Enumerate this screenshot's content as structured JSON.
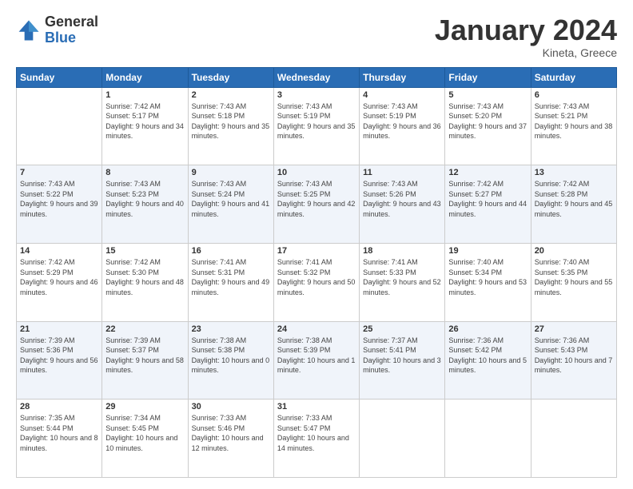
{
  "logo": {
    "general": "General",
    "blue": "Blue"
  },
  "header": {
    "month": "January 2024",
    "location": "Kineta, Greece"
  },
  "weekdays": [
    "Sunday",
    "Monday",
    "Tuesday",
    "Wednesday",
    "Thursday",
    "Friday",
    "Saturday"
  ],
  "weeks": [
    [
      {
        "day": "",
        "sunrise": "",
        "sunset": "",
        "daylight": ""
      },
      {
        "day": "1",
        "sunrise": "Sunrise: 7:42 AM",
        "sunset": "Sunset: 5:17 PM",
        "daylight": "Daylight: 9 hours and 34 minutes."
      },
      {
        "day": "2",
        "sunrise": "Sunrise: 7:43 AM",
        "sunset": "Sunset: 5:18 PM",
        "daylight": "Daylight: 9 hours and 35 minutes."
      },
      {
        "day": "3",
        "sunrise": "Sunrise: 7:43 AM",
        "sunset": "Sunset: 5:19 PM",
        "daylight": "Daylight: 9 hours and 35 minutes."
      },
      {
        "day": "4",
        "sunrise": "Sunrise: 7:43 AM",
        "sunset": "Sunset: 5:19 PM",
        "daylight": "Daylight: 9 hours and 36 minutes."
      },
      {
        "day": "5",
        "sunrise": "Sunrise: 7:43 AM",
        "sunset": "Sunset: 5:20 PM",
        "daylight": "Daylight: 9 hours and 37 minutes."
      },
      {
        "day": "6",
        "sunrise": "Sunrise: 7:43 AM",
        "sunset": "Sunset: 5:21 PM",
        "daylight": "Daylight: 9 hours and 38 minutes."
      }
    ],
    [
      {
        "day": "7",
        "sunrise": "Sunrise: 7:43 AM",
        "sunset": "Sunset: 5:22 PM",
        "daylight": "Daylight: 9 hours and 39 minutes."
      },
      {
        "day": "8",
        "sunrise": "Sunrise: 7:43 AM",
        "sunset": "Sunset: 5:23 PM",
        "daylight": "Daylight: 9 hours and 40 minutes."
      },
      {
        "day": "9",
        "sunrise": "Sunrise: 7:43 AM",
        "sunset": "Sunset: 5:24 PM",
        "daylight": "Daylight: 9 hours and 41 minutes."
      },
      {
        "day": "10",
        "sunrise": "Sunrise: 7:43 AM",
        "sunset": "Sunset: 5:25 PM",
        "daylight": "Daylight: 9 hours and 42 minutes."
      },
      {
        "day": "11",
        "sunrise": "Sunrise: 7:43 AM",
        "sunset": "Sunset: 5:26 PM",
        "daylight": "Daylight: 9 hours and 43 minutes."
      },
      {
        "day": "12",
        "sunrise": "Sunrise: 7:42 AM",
        "sunset": "Sunset: 5:27 PM",
        "daylight": "Daylight: 9 hours and 44 minutes."
      },
      {
        "day": "13",
        "sunrise": "Sunrise: 7:42 AM",
        "sunset": "Sunset: 5:28 PM",
        "daylight": "Daylight: 9 hours and 45 minutes."
      }
    ],
    [
      {
        "day": "14",
        "sunrise": "Sunrise: 7:42 AM",
        "sunset": "Sunset: 5:29 PM",
        "daylight": "Daylight: 9 hours and 46 minutes."
      },
      {
        "day": "15",
        "sunrise": "Sunrise: 7:42 AM",
        "sunset": "Sunset: 5:30 PM",
        "daylight": "Daylight: 9 hours and 48 minutes."
      },
      {
        "day": "16",
        "sunrise": "Sunrise: 7:41 AM",
        "sunset": "Sunset: 5:31 PM",
        "daylight": "Daylight: 9 hours and 49 minutes."
      },
      {
        "day": "17",
        "sunrise": "Sunrise: 7:41 AM",
        "sunset": "Sunset: 5:32 PM",
        "daylight": "Daylight: 9 hours and 50 minutes."
      },
      {
        "day": "18",
        "sunrise": "Sunrise: 7:41 AM",
        "sunset": "Sunset: 5:33 PM",
        "daylight": "Daylight: 9 hours and 52 minutes."
      },
      {
        "day": "19",
        "sunrise": "Sunrise: 7:40 AM",
        "sunset": "Sunset: 5:34 PM",
        "daylight": "Daylight: 9 hours and 53 minutes."
      },
      {
        "day": "20",
        "sunrise": "Sunrise: 7:40 AM",
        "sunset": "Sunset: 5:35 PM",
        "daylight": "Daylight: 9 hours and 55 minutes."
      }
    ],
    [
      {
        "day": "21",
        "sunrise": "Sunrise: 7:39 AM",
        "sunset": "Sunset: 5:36 PM",
        "daylight": "Daylight: 9 hours and 56 minutes."
      },
      {
        "day": "22",
        "sunrise": "Sunrise: 7:39 AM",
        "sunset": "Sunset: 5:37 PM",
        "daylight": "Daylight: 9 hours and 58 minutes."
      },
      {
        "day": "23",
        "sunrise": "Sunrise: 7:38 AM",
        "sunset": "Sunset: 5:38 PM",
        "daylight": "Daylight: 10 hours and 0 minutes."
      },
      {
        "day": "24",
        "sunrise": "Sunrise: 7:38 AM",
        "sunset": "Sunset: 5:39 PM",
        "daylight": "Daylight: 10 hours and 1 minute."
      },
      {
        "day": "25",
        "sunrise": "Sunrise: 7:37 AM",
        "sunset": "Sunset: 5:41 PM",
        "daylight": "Daylight: 10 hours and 3 minutes."
      },
      {
        "day": "26",
        "sunrise": "Sunrise: 7:36 AM",
        "sunset": "Sunset: 5:42 PM",
        "daylight": "Daylight: 10 hours and 5 minutes."
      },
      {
        "day": "27",
        "sunrise": "Sunrise: 7:36 AM",
        "sunset": "Sunset: 5:43 PM",
        "daylight": "Daylight: 10 hours and 7 minutes."
      }
    ],
    [
      {
        "day": "28",
        "sunrise": "Sunrise: 7:35 AM",
        "sunset": "Sunset: 5:44 PM",
        "daylight": "Daylight: 10 hours and 8 minutes."
      },
      {
        "day": "29",
        "sunrise": "Sunrise: 7:34 AM",
        "sunset": "Sunset: 5:45 PM",
        "daylight": "Daylight: 10 hours and 10 minutes."
      },
      {
        "day": "30",
        "sunrise": "Sunrise: 7:33 AM",
        "sunset": "Sunset: 5:46 PM",
        "daylight": "Daylight: 10 hours and 12 minutes."
      },
      {
        "day": "31",
        "sunrise": "Sunrise: 7:33 AM",
        "sunset": "Sunset: 5:47 PM",
        "daylight": "Daylight: 10 hours and 14 minutes."
      },
      {
        "day": "",
        "sunrise": "",
        "sunset": "",
        "daylight": ""
      },
      {
        "day": "",
        "sunrise": "",
        "sunset": "",
        "daylight": ""
      },
      {
        "day": "",
        "sunrise": "",
        "sunset": "",
        "daylight": ""
      }
    ]
  ]
}
